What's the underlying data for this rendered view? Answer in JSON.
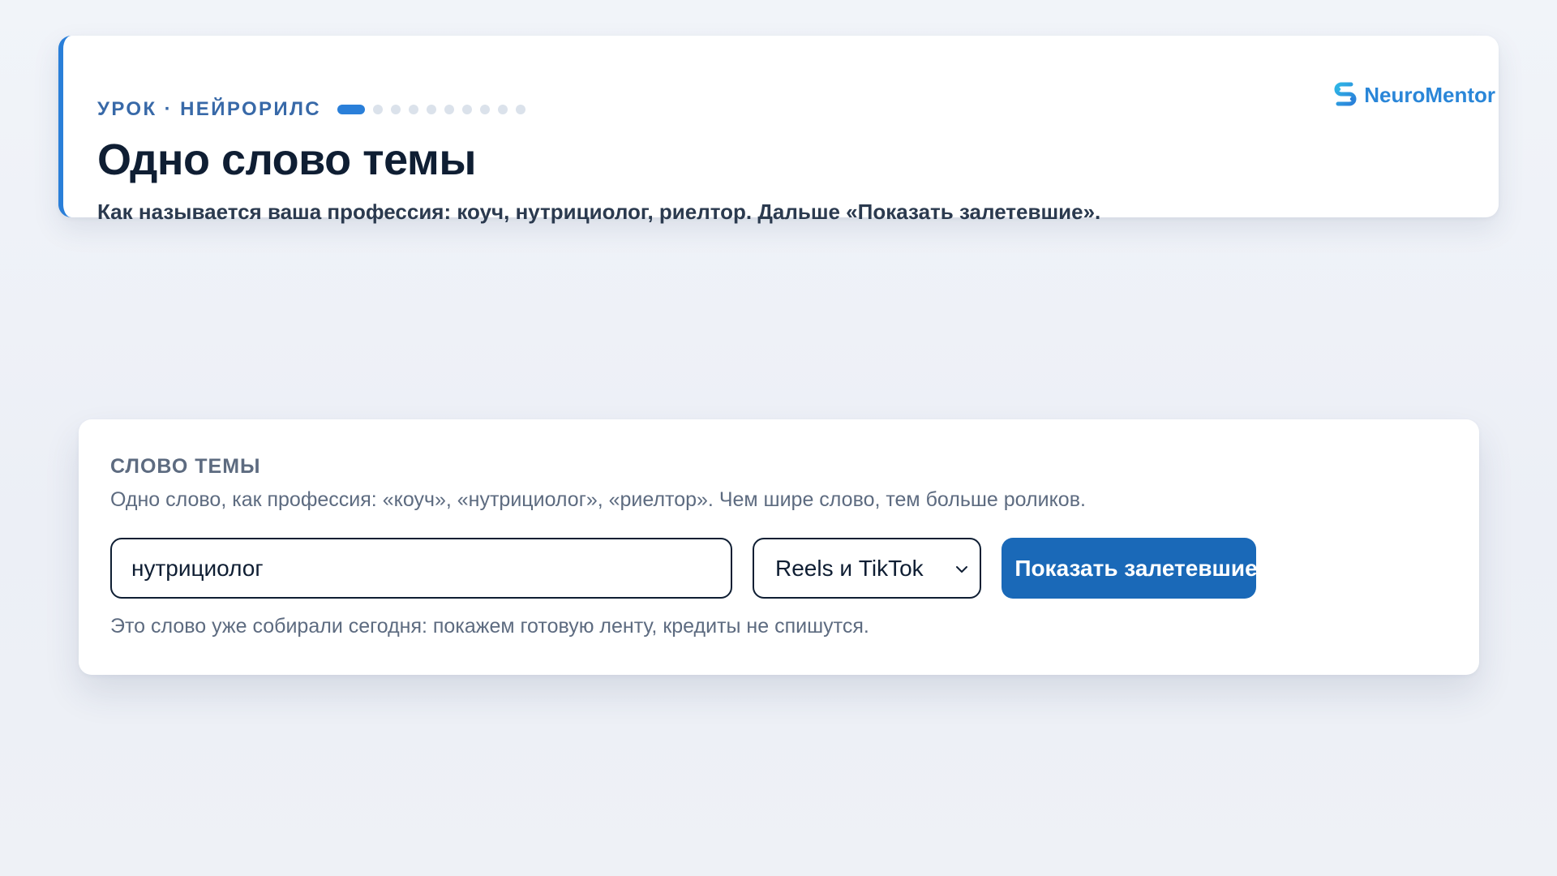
{
  "header": {
    "eyebrow": "УРОК · НЕЙРОРИЛС",
    "progress": {
      "current": 1,
      "total": 10
    },
    "title": "Одно слово темы",
    "subtitle": "Как называется ваша профессия: коуч, нутрициолог, риелтор. Дальше «Показать залетевшие».",
    "brand": {
      "name": "NeuroMentor",
      "icon": "brand-logo-icon"
    }
  },
  "search": {
    "label": "СЛОВО ТЕМЫ",
    "hint": "Одно слово, как профессия: «коуч», «нутрициолог», «риелтор». Чем шире слово, тем больше роликов.",
    "input_value": "нутрициолог",
    "platform_selected": "Reels и TikTok",
    "button_label": "Показать залетевшие",
    "button_icon": "sparkle-icon",
    "note": "Это слово уже собирали сегодня: покажем готовую ленту, кредиты не спишутся."
  },
  "colors": {
    "accent": "#2a7fd9",
    "button": "#1a69b8",
    "brand": "#2a86d8",
    "title": "#0f1e33",
    "muted": "#5d6b80"
  }
}
